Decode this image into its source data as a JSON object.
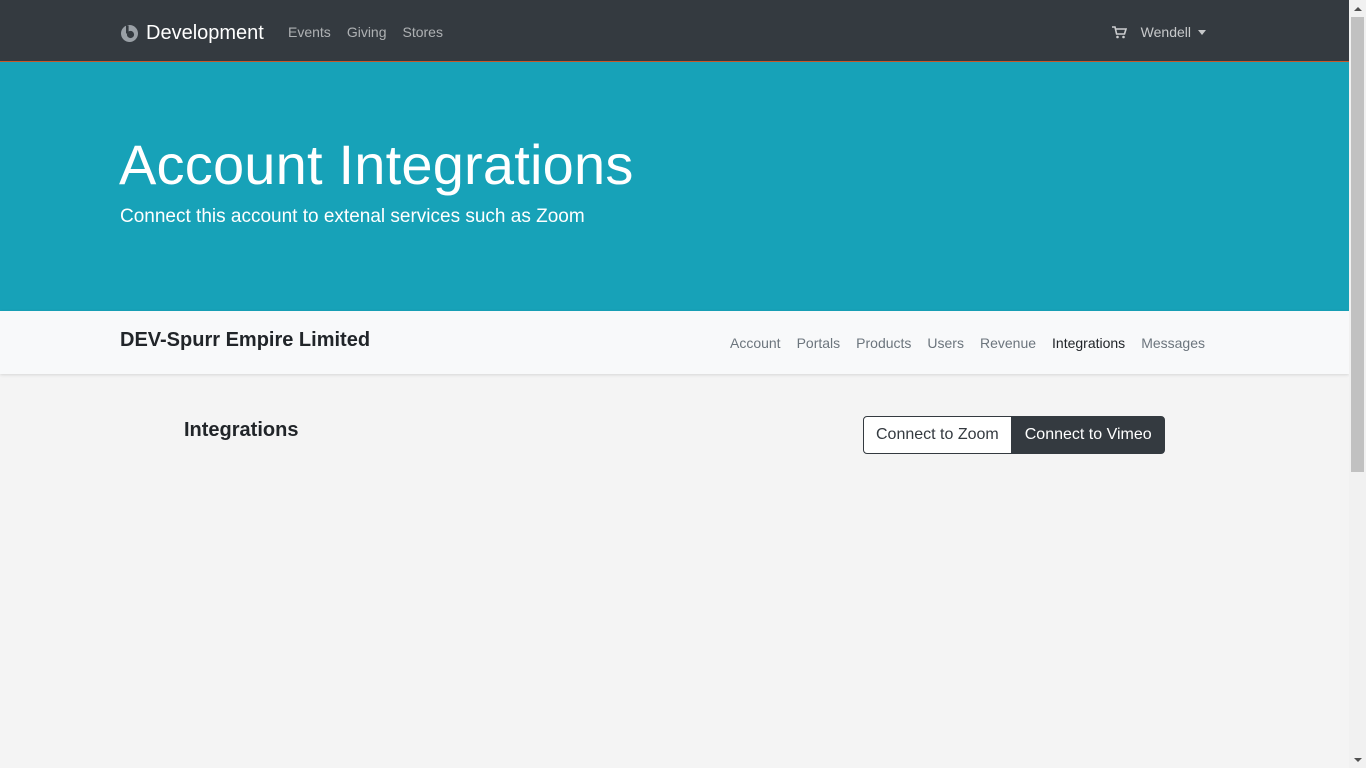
{
  "navbar": {
    "brand_label": "Development",
    "brand_icon": "brand-logo-icon",
    "links": [
      {
        "label": "Events"
      },
      {
        "label": "Giving"
      },
      {
        "label": "Stores"
      }
    ],
    "cart_icon": "cart-icon",
    "user_label": "Wendell",
    "background": "#343a40"
  },
  "hero": {
    "title": "Account Integrations",
    "subtitle": "Connect this account to extenal services such as Zoom",
    "background": "#17a2b8"
  },
  "subnav": {
    "org_name": "DEV-Spurr Empire Limited",
    "links": [
      {
        "label": "Account"
      },
      {
        "label": "Portals"
      },
      {
        "label": "Products"
      },
      {
        "label": "Users"
      },
      {
        "label": "Revenue"
      },
      {
        "label": "Integrations",
        "active": true
      },
      {
        "label": "Messages"
      }
    ]
  },
  "content": {
    "section_title": "Integrations",
    "buttons": {
      "zoom_label": "Connect to Zoom",
      "vimeo_label": "Connect to Vimeo"
    }
  }
}
